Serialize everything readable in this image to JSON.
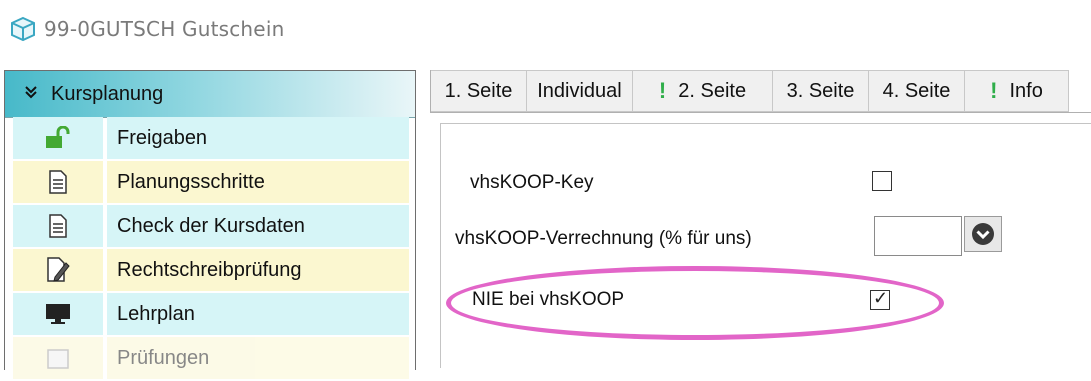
{
  "window": {
    "title": "99-0GUTSCH Gutschein",
    "icon": "cube-icon"
  },
  "sidebar": {
    "header_label": "Kursplanung",
    "header_icon": "double-chevron-down-icon",
    "items": [
      {
        "label": "Freigaben",
        "icon": "unlock-icon",
        "style": "cyan"
      },
      {
        "label": "Planungsschritte",
        "icon": "document-icon",
        "style": "yellow"
      },
      {
        "label": "Check der Kursdaten",
        "icon": "document-icon",
        "style": "cyan"
      },
      {
        "label": "Rechtschreibprüfung",
        "icon": "edit-document-icon",
        "style": "yellow"
      },
      {
        "label": "Lehrplan",
        "icon": "monitor-icon",
        "style": "cyan"
      },
      {
        "label": "Prüfungen",
        "icon": "calendar-icon",
        "style": "yellow"
      }
    ]
  },
  "tabs": [
    {
      "label": "1. Seite",
      "warning": false
    },
    {
      "label": "Individual",
      "warning": false
    },
    {
      "label": "2. Seite",
      "warning": true
    },
    {
      "label": "3. Seite",
      "warning": false
    },
    {
      "label": "4. Seite",
      "warning": false
    },
    {
      "label": "Info",
      "warning": true
    }
  ],
  "form": {
    "koop_key_label": "vhsKOOP-Key",
    "koop_key_checked": false,
    "koop_verrechnung_label": "vhsKOOP-Verrechnung (% für uns)",
    "koop_verrechnung_value": "",
    "nie_label": "NIE bei vhsKOOP",
    "nie_checked": true
  },
  "colors": {
    "accent_teal": "#47b9c9",
    "highlight_pink": "#e265c8",
    "warning_green": "#2fae4a"
  }
}
